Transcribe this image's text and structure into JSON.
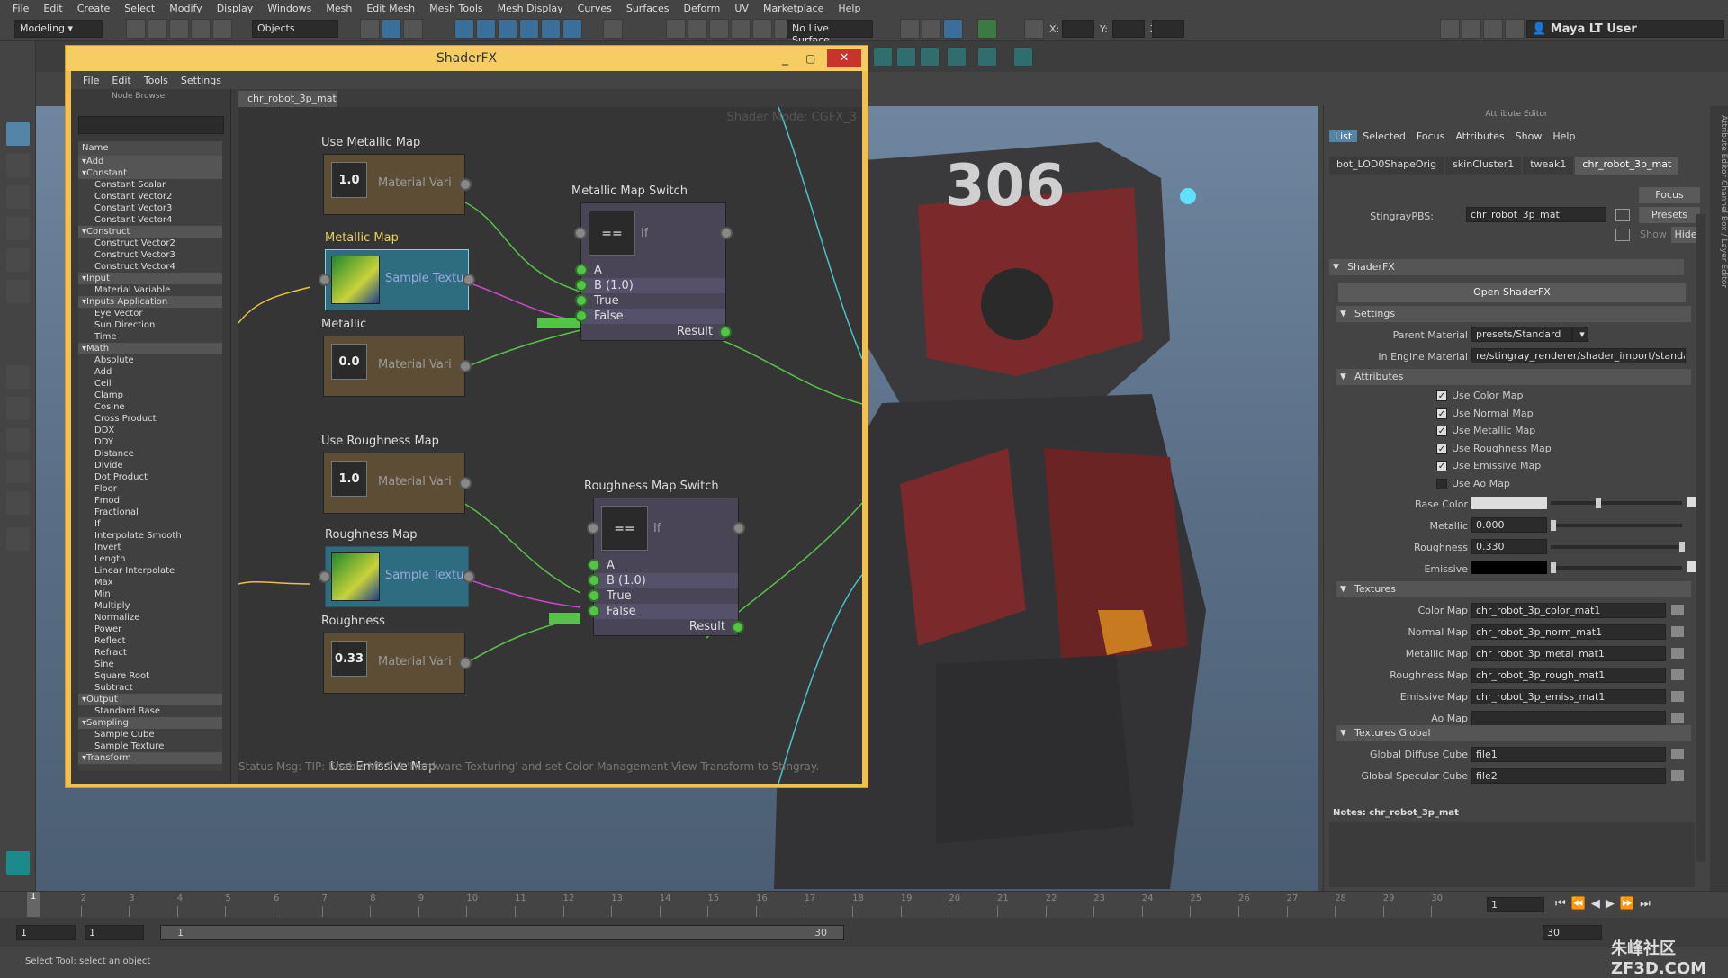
{
  "menubar": [
    "File",
    "Edit",
    "Create",
    "Select",
    "Modify",
    "Display",
    "Windows",
    "Mesh",
    "Edit Mesh",
    "Mesh Tools",
    "Mesh Display",
    "Curves",
    "Surfaces",
    "Deform",
    "UV",
    "Marketplace",
    "Help"
  ],
  "status": {
    "mode": "Modeling",
    "objects": "Objects",
    "live_surface": "No Live Surface",
    "x_label": "X:",
    "y_label": "Y:",
    "z_label": "Z:",
    "user": "Maya LT User"
  },
  "shaderfx": {
    "title": "ShaderFX",
    "menu": [
      "File",
      "Edit",
      "Tools",
      "Settings"
    ],
    "node_browser_title": "Node Browser",
    "graph_tab": "chr_robot_3p_mat",
    "shader_mode": "Shader Mode: CGFX_3",
    "list_header": "Name",
    "list": [
      {
        "t": "cat",
        "v": "Add"
      },
      {
        "t": "cat",
        "v": "Constant"
      },
      {
        "t": "it",
        "v": "Constant Scalar"
      },
      {
        "t": "it",
        "v": "Constant Vector2"
      },
      {
        "t": "it",
        "v": "Constant Vector3"
      },
      {
        "t": "it",
        "v": "Constant Vector4"
      },
      {
        "t": "cat",
        "v": "Construct"
      },
      {
        "t": "it",
        "v": "Construct Vector2"
      },
      {
        "t": "it",
        "v": "Construct Vector3"
      },
      {
        "t": "it",
        "v": "Construct Vector4"
      },
      {
        "t": "cat",
        "v": "Input"
      },
      {
        "t": "it",
        "v": "Material Variable"
      },
      {
        "t": "cat",
        "v": "Inputs Application"
      },
      {
        "t": "it",
        "v": "Eye Vector"
      },
      {
        "t": "it",
        "v": "Sun Direction"
      },
      {
        "t": "it",
        "v": "Time"
      },
      {
        "t": "cat",
        "v": "Math"
      },
      {
        "t": "it",
        "v": "Absolute"
      },
      {
        "t": "it",
        "v": "Add"
      },
      {
        "t": "it",
        "v": "Ceil"
      },
      {
        "t": "it",
        "v": "Clamp"
      },
      {
        "t": "it",
        "v": "Cosine"
      },
      {
        "t": "it",
        "v": "Cross Product"
      },
      {
        "t": "it",
        "v": "DDX"
      },
      {
        "t": "it",
        "v": "DDY"
      },
      {
        "t": "it",
        "v": "Distance"
      },
      {
        "t": "it",
        "v": "Divide"
      },
      {
        "t": "it",
        "v": "Dot Product"
      },
      {
        "t": "it",
        "v": "Floor"
      },
      {
        "t": "it",
        "v": "Fmod"
      },
      {
        "t": "it",
        "v": "Fractional"
      },
      {
        "t": "it",
        "v": "If"
      },
      {
        "t": "it",
        "v": "Interpolate Smooth"
      },
      {
        "t": "it",
        "v": "Invert"
      },
      {
        "t": "it",
        "v": "Length"
      },
      {
        "t": "it",
        "v": "Linear Interpolate"
      },
      {
        "t": "it",
        "v": "Max"
      },
      {
        "t": "it",
        "v": "Min"
      },
      {
        "t": "it",
        "v": "Multiply"
      },
      {
        "t": "it",
        "v": "Normalize"
      },
      {
        "t": "it",
        "v": "Power"
      },
      {
        "t": "it",
        "v": "Reflect"
      },
      {
        "t": "it",
        "v": "Refract"
      },
      {
        "t": "it",
        "v": "Sine"
      },
      {
        "t": "it",
        "v": "Square Root"
      },
      {
        "t": "it",
        "v": "Subtract"
      },
      {
        "t": "cat",
        "v": "Output"
      },
      {
        "t": "it",
        "v": "Standard Base"
      },
      {
        "t": "cat",
        "v": "Sampling"
      },
      {
        "t": "it",
        "v": "Sample Cube"
      },
      {
        "t": "it",
        "v": "Sample Texture"
      },
      {
        "t": "cat",
        "v": "Transform"
      }
    ],
    "nodes": {
      "use_metallic_map": {
        "title": "Use Metallic Map",
        "value": "1.0",
        "label": "Material Vari"
      },
      "metallic_map": {
        "title": "Metallic Map",
        "label": "Sample Textu"
      },
      "metallic": {
        "title": "Metallic",
        "value": "0.0",
        "label": "Material Vari"
      },
      "metallic_switch": {
        "title": "Metallic Map Switch",
        "op": "==",
        "if": "If",
        "ports": [
          "A",
          "B (1.0)",
          "True",
          "False"
        ],
        "result": "Result"
      },
      "use_roughness_map": {
        "title": "Use Roughness Map",
        "value": "1.0",
        "label": "Material Vari"
      },
      "roughness_map": {
        "title": "Roughness Map",
        "label": "Sample Textu"
      },
      "roughness": {
        "title": "Roughness",
        "value": "0.33",
        "label": "Material Vari"
      },
      "roughness_switch": {
        "title": "Roughness Map Switch",
        "op": "==",
        "if": "If",
        "ports": [
          "A",
          "B (1.0)",
          "True",
          "False"
        ],
        "result": "Result"
      },
      "use_emissive_map": {
        "title": "Use Emissive Map"
      }
    },
    "status": "Status Msg: TIP: Enable VP 2.0 'Hardware Texturing' and set Color Management View Transform to Stingray."
  },
  "attribute_editor": {
    "title": "Attribute Editor",
    "menu": [
      "List",
      "Selected",
      "Focus",
      "Attributes",
      "Show",
      "Help"
    ],
    "tabs": [
      "bot_LOD0ShapeOrig",
      "skinCluster1",
      "tweak1",
      "chr_robot_3p_mat"
    ],
    "node_type": "StingrayPBS:",
    "node_name": "chr_robot_3p_mat",
    "focus": "Focus",
    "presets": "Presets",
    "show": "Show",
    "hide": "Hide",
    "sections": {
      "shaderfx": "ShaderFX",
      "settings": "Settings",
      "attributes": "Attributes",
      "textures": "Textures",
      "textures_global": "Textures Global"
    },
    "open_shaderfx": "Open ShaderFX",
    "parent_material_label": "Parent Material",
    "parent_material": "presets/Standard",
    "in_engine_label": "In Engine Material",
    "in_engine": "re/stingray_renderer/shader_import/standard",
    "checks": [
      {
        "label": "Use Color Map",
        "on": true
      },
      {
        "label": "Use Normal Map",
        "on": true
      },
      {
        "label": "Use Metallic Map",
        "on": true
      },
      {
        "label": "Use Roughness Map",
        "on": true
      },
      {
        "label": "Use Emissive Map",
        "on": true
      },
      {
        "label": "Use Ao Map",
        "on": false
      }
    ],
    "base_color_label": "Base Color",
    "metallic_label": "Metallic",
    "metallic": "0.000",
    "roughness_label": "Roughness",
    "roughness": "0.330",
    "emissive_label": "Emissive",
    "textures": [
      {
        "label": "Color Map",
        "value": "chr_robot_3p_color_mat1"
      },
      {
        "label": "Normal Map",
        "value": "chr_robot_3p_norm_mat1"
      },
      {
        "label": "Metallic Map",
        "value": "chr_robot_3p_metal_mat1"
      },
      {
        "label": "Roughness Map",
        "value": "chr_robot_3p_rough_mat1"
      },
      {
        "label": "Emissive Map",
        "value": "chr_robot_3p_emiss_mat1"
      },
      {
        "label": "Ao Map",
        "value": ""
      }
    ],
    "global": [
      {
        "label": "Global Diffuse Cube",
        "value": "file1"
      },
      {
        "label": "Global Specular Cube",
        "value": "file2"
      }
    ],
    "notes": "Notes:  chr_robot_3p_mat",
    "side_tabs": "Attribute Editor   Channel Box / Layer Editor"
  },
  "timeline": {
    "ticks": [
      "1",
      "2",
      "3",
      "4",
      "5",
      "6",
      "7",
      "8",
      "9",
      "10",
      "11",
      "12",
      "13",
      "14",
      "15",
      "16",
      "17",
      "18",
      "19",
      "20",
      "21",
      "22",
      "23",
      "24",
      "25",
      "26",
      "27",
      "28",
      "29",
      "30"
    ],
    "current": "1",
    "current_field": "1"
  },
  "range": {
    "start": "1",
    "start2": "1",
    "range_start": "1",
    "range_end": "30",
    "end": "30"
  },
  "help_line": "Select Tool: select an object",
  "watermark": "朱峰社区 ZF3D.COM"
}
